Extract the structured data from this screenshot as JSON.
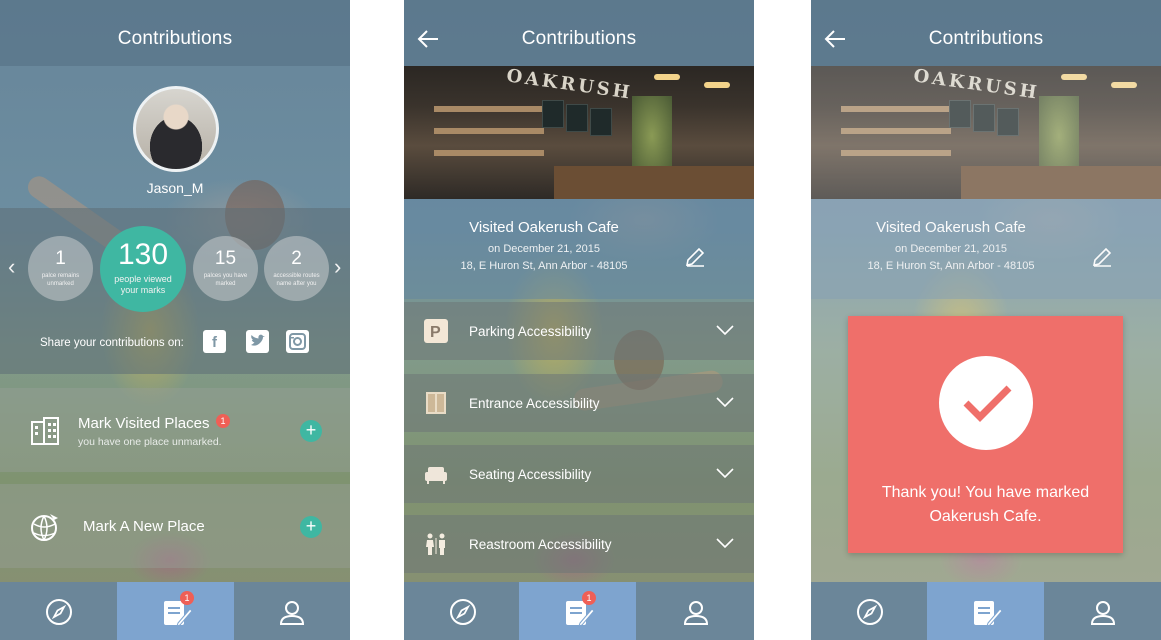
{
  "screens": {
    "profile": {
      "title": "Contributions",
      "username": "Jason_M",
      "stats": [
        {
          "value": "1",
          "label": "palce remains unmarked"
        },
        {
          "value": "130",
          "label": "people viewed your marks"
        },
        {
          "value": "15",
          "label": "palces you have marked"
        },
        {
          "value": "2",
          "label": "accessible routes name after you"
        }
      ],
      "share_label": "Share your contributions on:",
      "social": [
        "facebook-icon",
        "twitter-icon",
        "instagram-icon"
      ],
      "actions": [
        {
          "title": "Mark Visited Places",
          "subtitle": "you have one place unmarked.",
          "badge": "1",
          "icon": "building-icon"
        },
        {
          "title": "Mark A New Place",
          "subtitle": "",
          "icon": "globe-plane-icon"
        }
      ]
    },
    "place": {
      "title": "Contributions",
      "cafe_sign": "OAKRUSH",
      "visit_title": "Visited Oakerush Cafe",
      "visit_date": "on December 21, 2015",
      "visit_address": "18, E Huron St, Ann Arbor - 48105",
      "accessibility": [
        {
          "label": "Parking Accessibility",
          "icon": "parking-icon"
        },
        {
          "label": "Entrance Accessibility",
          "icon": "door-icon"
        },
        {
          "label": "Seating Accessibility",
          "icon": "sofa-icon"
        },
        {
          "label": "Reastroom Accessibility",
          "icon": "restroom-icon"
        }
      ]
    },
    "confirm": {
      "title": "Contributions",
      "cafe_sign": "OAKRUSH",
      "visit_title": "Visited Oakerush Cafe",
      "visit_date": "on December 21, 2015",
      "visit_address": "18, E Huron St, Ann Arbor - 48105",
      "modal_message": "Thank you! You have marked Oakerush Cafe."
    }
  },
  "nav": {
    "items": [
      "compass-icon",
      "contributions-icon",
      "profile-icon"
    ],
    "badge": "1",
    "active_color": "#7ea4cf"
  },
  "colors": {
    "accent": "#3fb7a2",
    "modal": "#ef6f6a",
    "badge": "#ef5f56"
  }
}
